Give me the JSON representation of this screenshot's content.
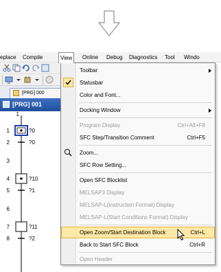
{
  "menubar": {
    "items": [
      {
        "label": "eplace",
        "name": "menu-replace"
      },
      {
        "label": "Compile",
        "name": "menu-compile"
      },
      {
        "label": "View",
        "name": "menu-view"
      },
      {
        "label": "Online",
        "name": "menu-online"
      },
      {
        "label": "Debug",
        "name": "menu-debug"
      },
      {
        "label": "Diagnostics",
        "name": "menu-diagnostics"
      },
      {
        "label": "Tool",
        "name": "menu-tool"
      },
      {
        "label": "Windo",
        "name": "menu-window"
      }
    ]
  },
  "tab": {
    "label": "[PRG] 000"
  },
  "editor": {
    "title": "[PRG] 001",
    "steps": [
      {
        "num": "1",
        "label": ""
      },
      {
        "num": "1",
        "label": "?0"
      },
      {
        "num": "2",
        "label": "?0"
      },
      {
        "num": "3",
        "label": ""
      },
      {
        "num": "4",
        "label": "?10"
      },
      {
        "num": "5",
        "label": "?1"
      },
      {
        "num": "6",
        "label": ""
      },
      {
        "num": "7",
        "label": "?11"
      },
      {
        "num": "8",
        "label": "?2"
      }
    ]
  },
  "view_menu": {
    "items": [
      {
        "label": "Toolbar",
        "shortcut": "",
        "submenu": true,
        "enabled": true
      },
      {
        "label": "Statusbar",
        "shortcut": "",
        "checked": true,
        "enabled": true
      },
      {
        "label": "Color and Font...",
        "shortcut": "",
        "enabled": true
      },
      {
        "label": "Docking Window",
        "shortcut": "",
        "submenu": true,
        "enabled": true
      },
      {
        "label": "Program Display",
        "shortcut": "Ctrl+Alt+F8",
        "enabled": false
      },
      {
        "label": "SFC Step/Transition Comment",
        "shortcut": "Ctrl+F5",
        "enabled": true
      },
      {
        "label": "Zoom...",
        "shortcut": "",
        "icon": "magnifier-icon",
        "enabled": true
      },
      {
        "label": "SFC Row Setting...",
        "shortcut": "",
        "enabled": true
      },
      {
        "label": "Open SFC Blocklist",
        "shortcut": "",
        "enabled": true
      },
      {
        "label": "MELSAP3 Display",
        "shortcut": "",
        "enabled": false
      },
      {
        "label": "MELSAP-L(Instruction Format) Display",
        "shortcut": "",
        "enabled": false
      },
      {
        "label": "MELSAP-L(Start Conditions Format) Display",
        "shortcut": "",
        "enabled": false
      },
      {
        "label": "Open Zoom/Start Destination Block",
        "shortcut": "Ctrl+L",
        "enabled": true,
        "highlighted": true
      },
      {
        "label": "Back to Start SFC Block",
        "shortcut": "Ctrl+R",
        "enabled": true
      },
      {
        "label": "Open Header",
        "shortcut": "",
        "enabled": false
      }
    ]
  },
  "colors": {
    "highlight": "#fde8a6",
    "title_bar": "#2a5bb0",
    "disabled_text": "#9a9a9a"
  }
}
